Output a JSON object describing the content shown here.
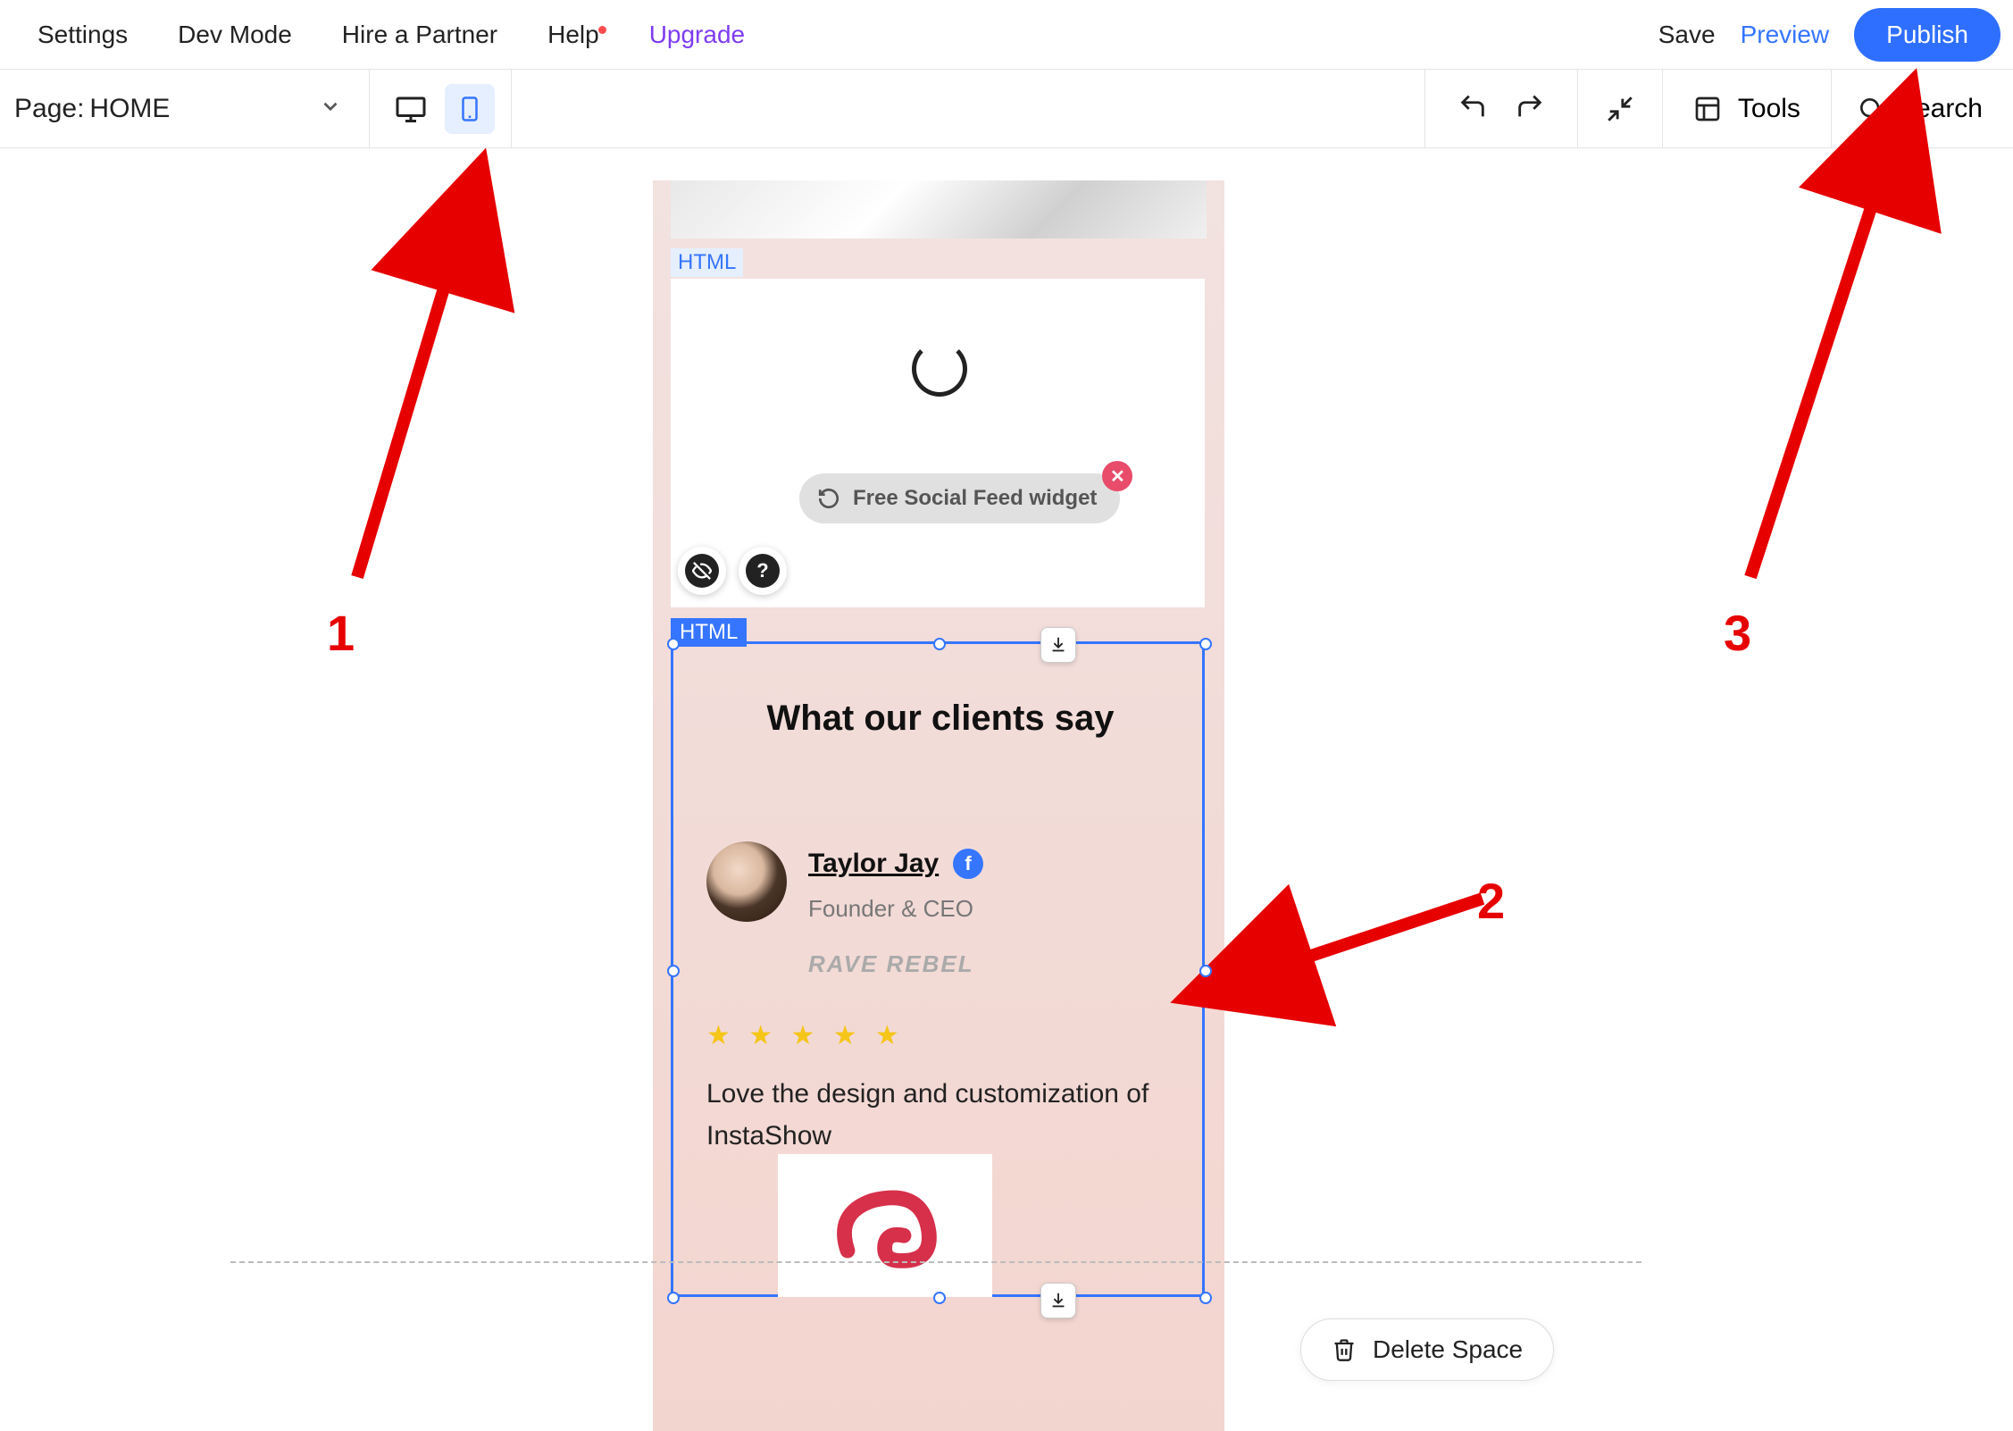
{
  "topMenu": {
    "settings": "Settings",
    "devMode": "Dev Mode",
    "hirePartner": "Hire a Partner",
    "help": "Help",
    "upgrade": "Upgrade",
    "save": "Save",
    "preview": "Preview",
    "publish": "Publish"
  },
  "secondBar": {
    "pageLabel": "Page:",
    "pageName": "HOME",
    "tools": "Tools",
    "search": "Search"
  },
  "mobilePreview": {
    "htmlLabel1": "HTML",
    "widgetLabel": "Free Social Feed widget",
    "htmlLabel2": "HTML",
    "testimonialsTitle": "What our clients say",
    "clientName": "Taylor Jay",
    "clientRole": "Founder & CEO",
    "clientCompany": "RAVE REBEL",
    "stars": "★ ★ ★ ★ ★",
    "reviewText": "Love the design and customization of InstaShow"
  },
  "deleteSpace": "Delete Space",
  "annotations": {
    "n1": "1",
    "n2": "2",
    "n3": "3"
  }
}
